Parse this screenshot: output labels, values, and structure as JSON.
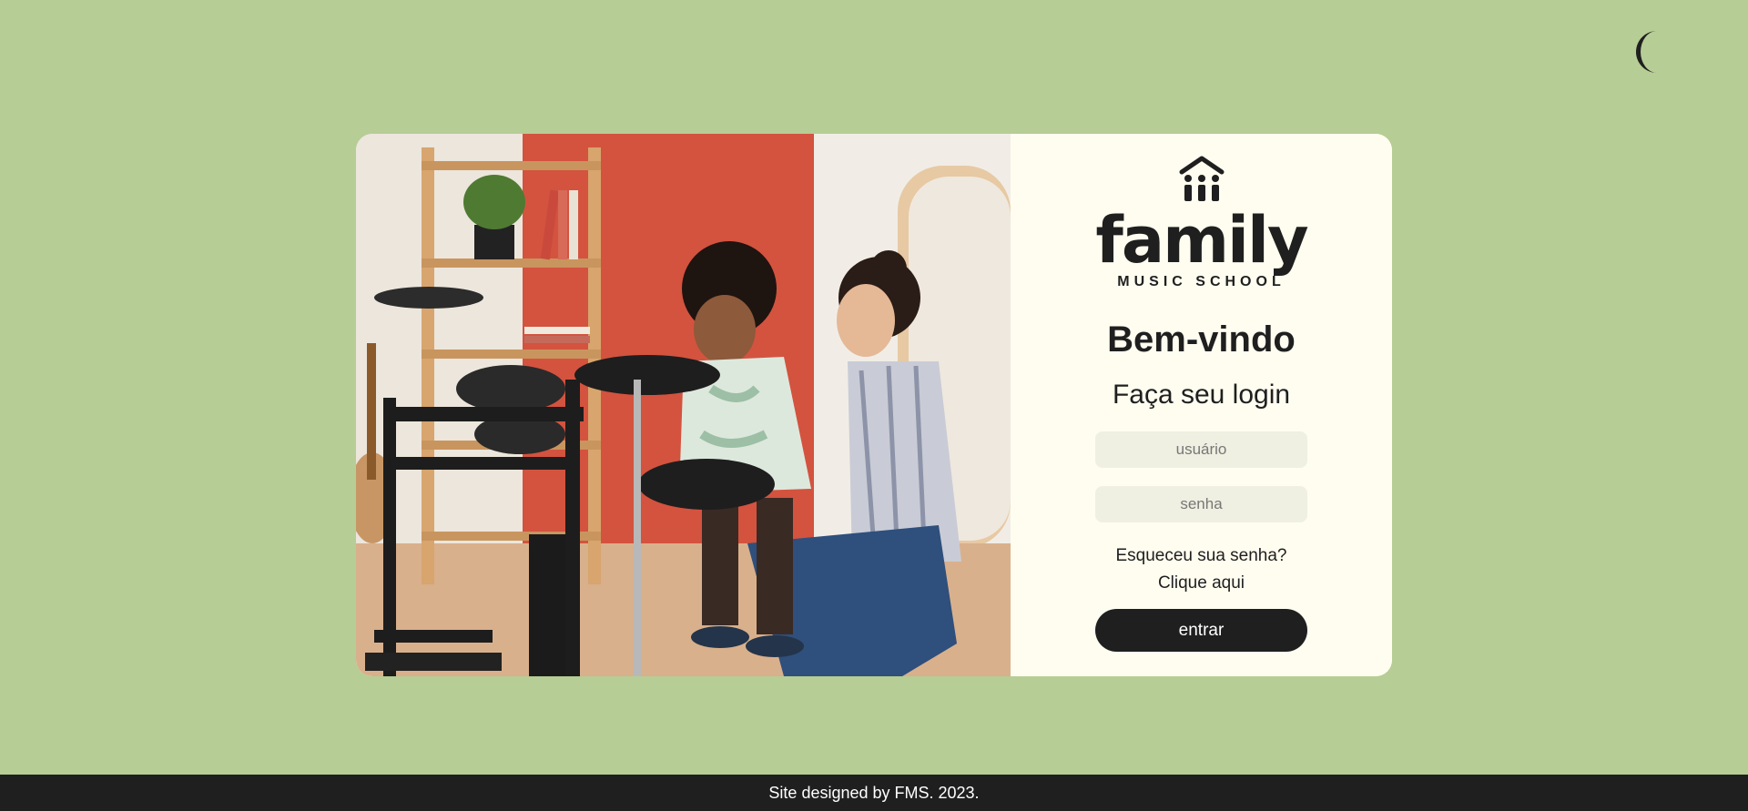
{
  "theme_toggle": {
    "icon": "moon-icon"
  },
  "logo": {
    "icon": "music-school-house-icon",
    "word": "family",
    "subtitle": "MUSIC SCHOOL"
  },
  "hero_image": {
    "icon": "drum-lesson-photo"
  },
  "login": {
    "welcome": "Bem-vindo",
    "subtitle": "Faça seu login",
    "username_placeholder": "usuário",
    "password_placeholder": "senha",
    "forgot_text": "Esqueceu sua senha?",
    "forgot_link": "Clique aqui",
    "submit_label": "entrar"
  },
  "footer": {
    "text": "Site designed by FMS. 2023."
  },
  "colors": {
    "background": "#b6cd95",
    "panel": "#fffdf0",
    "input": "#efefe2",
    "dark": "#1f1f1f"
  }
}
